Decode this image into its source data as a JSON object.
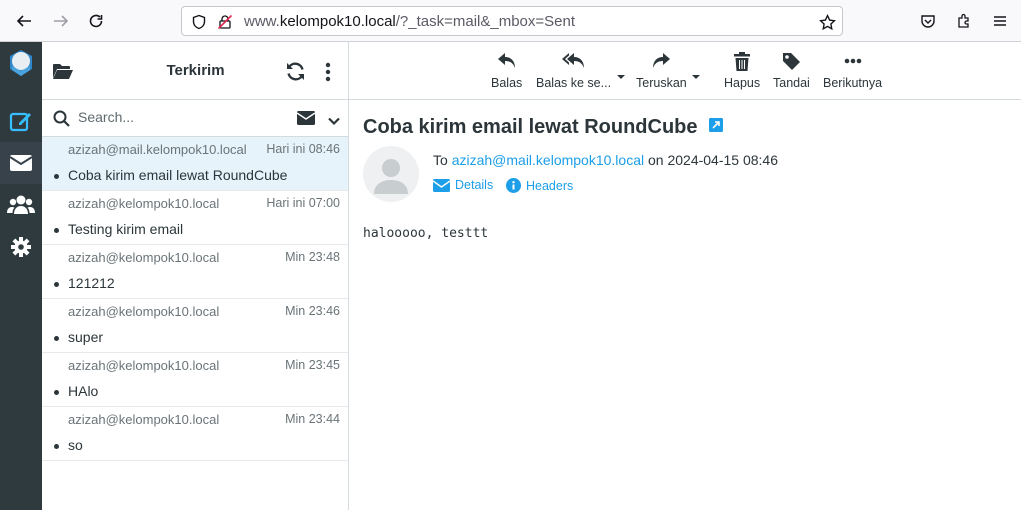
{
  "browser": {
    "url_prefix": "www.",
    "url_domain": "kelompok10.local",
    "url_path": "/?_task=mail&_mbox=Sent"
  },
  "taskmenu": {
    "items": [
      "compose",
      "mail",
      "contacts",
      "settings"
    ]
  },
  "list": {
    "title": "Terkirim",
    "search_placeholder": "Search...",
    "messages": [
      {
        "from": "azizah@mail.kelompok10.local",
        "date": "Hari ini 08:46",
        "subject": "Coba kirim email lewat RoundCube"
      },
      {
        "from": "azizah@kelompok10.local",
        "date": "Hari ini 07:00",
        "subject": "Testing kirim email"
      },
      {
        "from": "azizah@kelompok10.local",
        "date": "Min 23:48",
        "subject": "121212"
      },
      {
        "from": "azizah@kelompok10.local",
        "date": "Min 23:46",
        "subject": "super"
      },
      {
        "from": "azizah@kelompok10.local",
        "date": "Min 23:45",
        "subject": "HAlo"
      },
      {
        "from": "azizah@kelompok10.local",
        "date": "Min 23:44",
        "subject": "so"
      }
    ]
  },
  "toolbar": {
    "reply": "Balas",
    "reply_all": "Balas ke se...",
    "forward": "Teruskan",
    "delete": "Hapus",
    "mark": "Tandai",
    "more": "Berikutnya"
  },
  "message": {
    "subject": "Coba kirim email lewat RoundCube",
    "to_label": "To",
    "to_address": "azizah@mail.kelompok10.local",
    "on_label": "on",
    "date": "2024-04-15 08:46",
    "details_label": "Details",
    "headers_label": "Headers",
    "body": "halooooo, testtt"
  },
  "colors": {
    "accent": "#1c9ee8",
    "taskmenu_bg": "#2f3a3f",
    "selected_row": "#e6f3fb"
  }
}
